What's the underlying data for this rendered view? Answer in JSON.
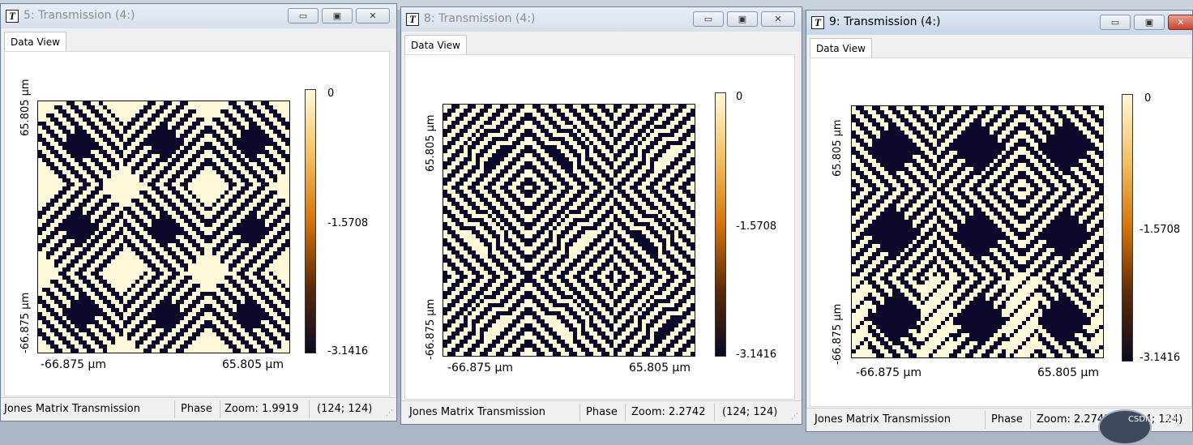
{
  "colors": {
    "dark": "#0b0a2a",
    "light": "#fff8d9",
    "colorbar_stops": [
      "#fff8d9",
      "#f2c060",
      "#d5730a",
      "#5b2a0a",
      "#0b0a25"
    ]
  },
  "windows": [
    {
      "title": "5: Transmission (4:)",
      "active": false,
      "tab": "Data View",
      "axis": {
        "y_top": "65.805 µm",
        "y_bottom": "-66.875 µm",
        "x_left": "-66.875 µm",
        "x_right": "65.805 µm"
      },
      "colorbar": {
        "max": "0",
        "mid": "-1.5708",
        "min": "-3.1416"
      },
      "status": {
        "name": "Jones Matrix Transmission",
        "mode": "Phase",
        "zoom": "Zoom: 1.9919",
        "coords": "(124; 124)"
      }
    },
    {
      "title": "8: Transmission (4:)",
      "active": false,
      "tab": "Data View",
      "axis": {
        "y_top": "65.805 µm",
        "y_bottom": "-66.875 µm",
        "x_left": "-66.875 µm",
        "x_right": "65.805 µm"
      },
      "colorbar": {
        "max": "0",
        "mid": "-1.5708",
        "min": "-3.1416"
      },
      "status": {
        "name": "Jones Matrix Transmission",
        "mode": "Phase",
        "zoom": "Zoom: 2.2742",
        "coords": "(124; 124)"
      }
    },
    {
      "title": "9: Transmission (4:)",
      "active": true,
      "tab": "Data View",
      "axis": {
        "y_top": "65.805 µm",
        "y_bottom": "-66.875 µm",
        "x_left": "-66.875 µm",
        "x_right": "65.805 µm"
      },
      "colorbar": {
        "max": "0",
        "mid": "-1.5708",
        "min": "-3.1416"
      },
      "status": {
        "name": "Jones Matrix Transmission",
        "mode": "Phase",
        "zoom": "Zoom: 2.2742",
        "coords": "(124; 124)"
      }
    }
  ],
  "controls": {
    "minimize": "▭",
    "maximize": "▣",
    "close": "✕"
  },
  "watermark": "CSDN @阎洲"
}
